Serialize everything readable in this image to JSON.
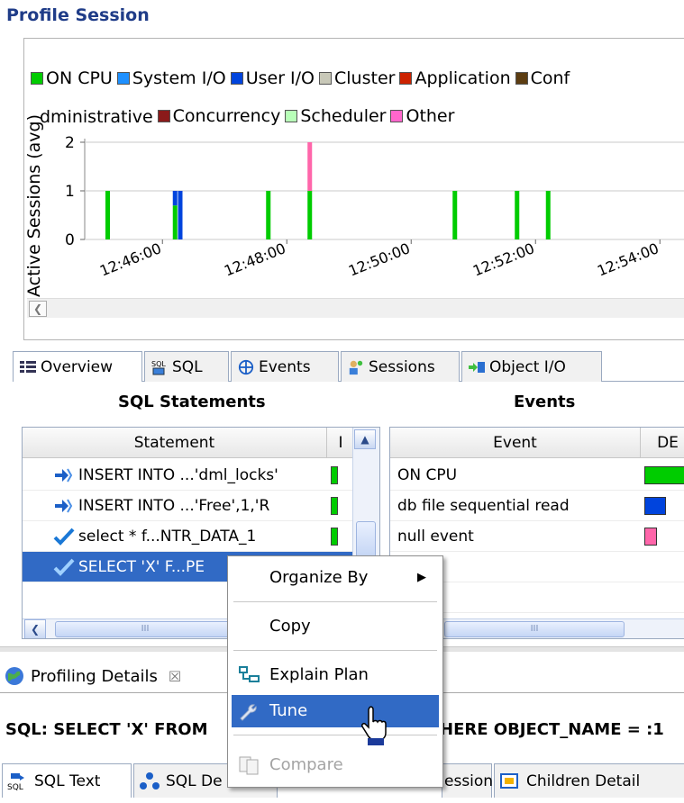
{
  "title": "Profile Session",
  "chart_data": {
    "type": "bar",
    "ylabel": "Active Sessions (avg)",
    "yticks": [
      "0",
      "1",
      "2"
    ],
    "xticks": [
      "12:46:00",
      "12:48:00",
      "12:50:00",
      "12:52:00",
      "12:54:00"
    ],
    "legend_row1": [
      {
        "name": "ON CPU",
        "color": "#00cc00"
      },
      {
        "name": "System I/O",
        "color": "#1e90ff"
      },
      {
        "name": "User I/O",
        "color": "#0044dd"
      },
      {
        "name": "Cluster",
        "color": "#c8c8b8"
      },
      {
        "name": "Application",
        "color": "#cc2200"
      },
      {
        "name": "Conf",
        "color": "#5c3d12"
      }
    ],
    "legend_row2": [
      {
        "name": "dministrative",
        "color": ""
      },
      {
        "name": "Concurrency",
        "color": "#8b1a1a"
      },
      {
        "name": "Scheduler",
        "color": "#b8ffb8"
      },
      {
        "name": "Other",
        "color": "#ff66cc"
      }
    ],
    "bars": [
      {
        "x": "12:45:05",
        "on_cpu": 1
      },
      {
        "x": "12:46:10",
        "on_cpu": 0.7,
        "user_io": 0.3
      },
      {
        "x": "12:46:15",
        "user_io": 1
      },
      {
        "x": "12:47:40",
        "on_cpu": 1
      },
      {
        "x": "12:48:20",
        "on_cpu": 1,
        "other": 1
      },
      {
        "x": "12:50:40",
        "on_cpu": 1
      },
      {
        "x": "12:51:40",
        "on_cpu": 1
      },
      {
        "x": "12:52:10",
        "on_cpu": 1
      }
    ],
    "ylim": [
      0,
      2
    ]
  },
  "tabs": [
    {
      "label": "Overview",
      "icon": "overview-icon"
    },
    {
      "label": "SQL",
      "icon": "sql-icon"
    },
    {
      "label": "Events",
      "icon": "events-icon"
    },
    {
      "label": "Sessions",
      "icon": "sessions-icon"
    },
    {
      "label": "Object I/O",
      "icon": "object-io-icon"
    }
  ],
  "sql_statements": {
    "heading": "SQL Statements",
    "columns": [
      "Statement",
      "I"
    ],
    "rows": [
      {
        "text": "INSERT INTO ...'dml_locks'",
        "icon": "insert-icon"
      },
      {
        "text": "INSERT INTO ...'Free',1,'R",
        "icon": "insert-icon"
      },
      {
        "text": "select * f...NTR_DATA_1",
        "icon": "check-icon"
      },
      {
        "text": "SELECT 'X' F...PE",
        "icon": "check-icon"
      }
    ]
  },
  "events": {
    "heading": "Events",
    "columns": [
      "Event",
      "DE"
    ],
    "rows": [
      {
        "text": "ON CPU",
        "color": "#00cc00"
      },
      {
        "text": "db file sequential read",
        "color": "#0044dd"
      },
      {
        "text": "null event",
        "color": "#ff66aa"
      }
    ]
  },
  "details": {
    "tab_label": "Profiling Details",
    "close": "☒",
    "sql_prefix": "SQL: SELECT 'X' FROM",
    "sql_suffix": "HERE OBJECT_NAME = :1",
    "bottom_tabs": [
      "SQL Text",
      "SQL De",
      "Events",
      "Sessions",
      "Children Detail"
    ]
  },
  "context_menu": {
    "organize_by": "Organize By",
    "copy": "Copy",
    "explain_plan": "Explain Plan",
    "tune": "Tune",
    "compare": "Compare"
  },
  "scroll_glyph": "III"
}
